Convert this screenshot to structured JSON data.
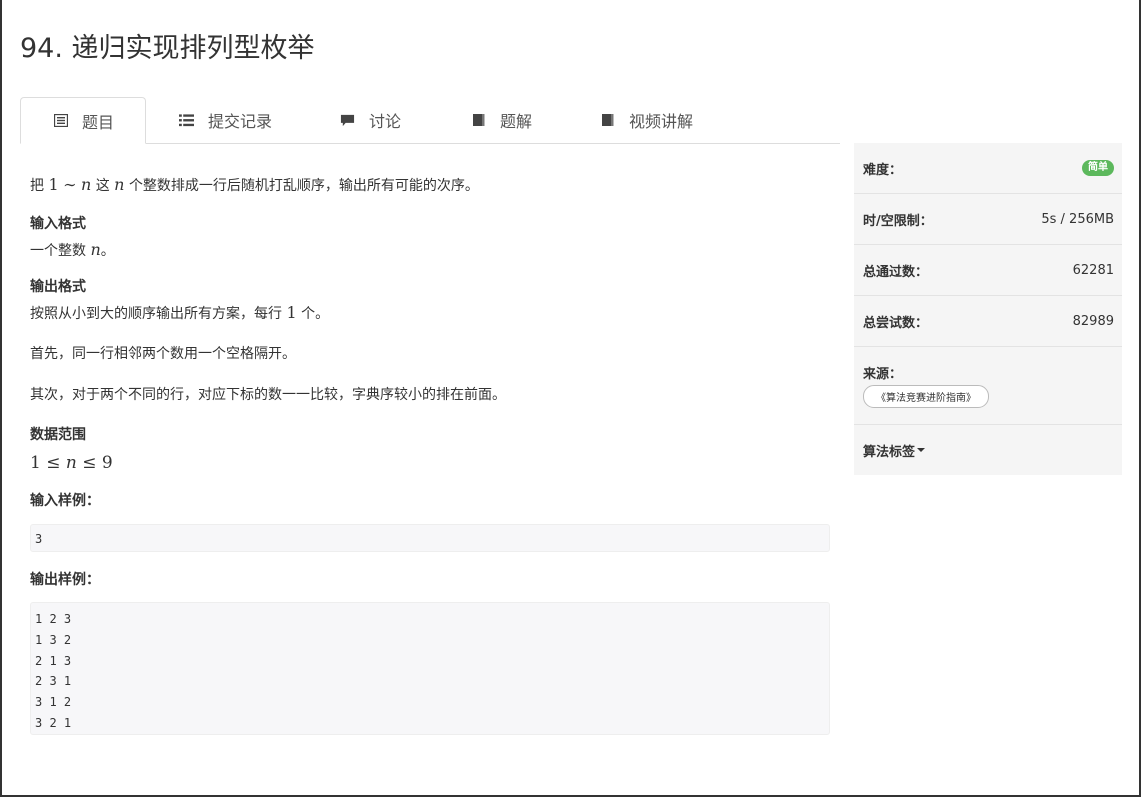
{
  "problem": {
    "title": "94. 递归实现排列型枚举"
  },
  "tabs": [
    {
      "label": "题目",
      "icon": "document-icon",
      "active": true
    },
    {
      "label": "提交记录",
      "icon": "list-icon"
    },
    {
      "label": "讨论",
      "icon": "comment-icon"
    },
    {
      "label": "题解",
      "icon": "book-icon"
    },
    {
      "label": "视频讲解",
      "icon": "book-icon"
    }
  ],
  "description": {
    "intro_prefix": "把",
    "intro_math_1": "1",
    "intro_tilde": "∼",
    "intro_math_n": "n",
    "intro_middle": "这",
    "intro_math_n2": "n",
    "intro_suffix": "个整数排成一行后随机打乱顺序，输出所有可能的次序。",
    "input_format_heading": "输入格式",
    "input_format_prefix": "一个整数",
    "input_format_math": "n",
    "input_format_suffix": "。",
    "output_format_heading": "输出格式",
    "output_line1_prefix": "按照从小到大的顺序输出所有方案，每行",
    "output_line1_math": "1",
    "output_line1_suffix": "个。",
    "output_line2": "首先，同一行相邻两个数用一个空格隔开。",
    "output_line3": "其次，对于两个不同的行，对应下标的数一一比较，字典序较小的排在前面。",
    "range_heading": "数据范围",
    "range_lo": "1",
    "range_le1": "≤",
    "range_n": "n",
    "range_le2": "≤",
    "range_hi": "9",
    "sample_input_heading": "输入样例：",
    "sample_input": "3",
    "sample_output_heading": "输出样例：",
    "sample_output": "1 2 3\n1 3 2\n2 1 3\n2 3 1\n3 1 2\n3 2 1"
  },
  "sidebar": {
    "difficulty_label": "难度：",
    "difficulty_value": "简单",
    "difficulty_color": "#5cb85c",
    "limit_label": "时/空限制：",
    "limit_value": "5s / 256MB",
    "accepted_label": "总通过数：",
    "accepted_value": "62281",
    "attempts_label": "总尝试数：",
    "attempts_value": "82989",
    "source_label": "来源：",
    "source_value": "《算法竞赛进阶指南》",
    "tags_label": "算法标签"
  }
}
